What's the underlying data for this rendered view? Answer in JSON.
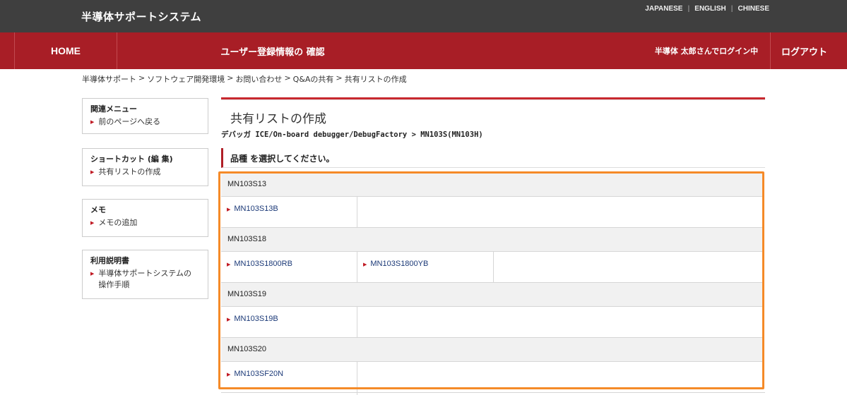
{
  "header": {
    "site_title": "半導体サポートシステム",
    "languages": [
      "JAPANESE",
      "ENGLISH",
      "CHINESE"
    ]
  },
  "nav": {
    "home": "HOME",
    "user_info": "ユーザー登録情報の 確認",
    "login_status": "半導体 太郎さんでログイン中",
    "logout": "ログアウト"
  },
  "breadcrumb": [
    "半導体サポート",
    "ソフトウェア開発環境",
    "お問い合わせ",
    "Q&Aの共有",
    "共有リストの作成"
  ],
  "sidebar": {
    "boxes": [
      {
        "title": "関連メニュー",
        "links": [
          "前のページへ戻る"
        ]
      },
      {
        "title": "ショートカット (編 集)",
        "links": [
          "共有リストの作成"
        ]
      },
      {
        "title": "メモ",
        "links": [
          "メモの追加"
        ]
      },
      {
        "title": "利用説明書",
        "links": [
          "半導体サポートシステムの操作手順"
        ]
      }
    ]
  },
  "main": {
    "heading": "共有リストの作成",
    "product_path": "デバッガ ICE/On-board debugger/DebugFactory > MN103S(MN103H)",
    "select_prompt": "品種 を選択してください。",
    "groups": [
      {
        "name": "MN103S13",
        "items": [
          "MN103S13B"
        ]
      },
      {
        "name": "MN103S18",
        "items": [
          "MN103S1800RB",
          "MN103S1800YB"
        ]
      },
      {
        "name": "MN103S19",
        "items": [
          "MN103S19B"
        ]
      },
      {
        "name": "MN103S20",
        "items": [
          "MN103SF20N"
        ]
      }
    ]
  },
  "colors": {
    "topbar": "#3f3f3f",
    "navbar": "#a81e26",
    "accent_red": "#c8282e",
    "highlight": "#f58a28",
    "link": "#1c3a78"
  },
  "icons": {
    "link_arrow": "triangle-right-icon"
  }
}
